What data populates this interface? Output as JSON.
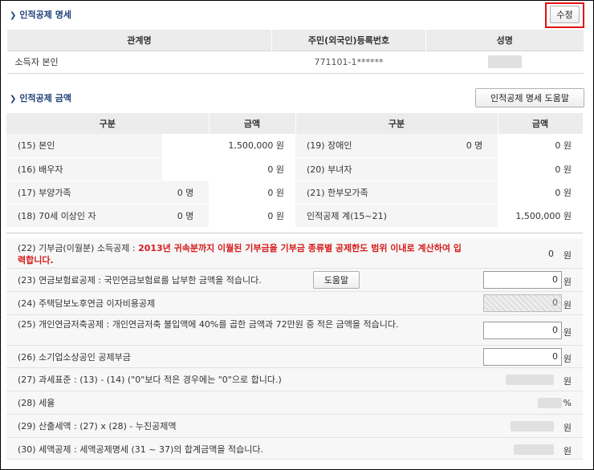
{
  "section1": {
    "title": "인적공제 명세",
    "edit_button": "수정"
  },
  "table1": {
    "headers": [
      "관계명",
      "주민(외국인)등록번호",
      "성명"
    ],
    "row": {
      "relation": "소득자 본인",
      "rrn_visible": "771101-1******",
      "name": ""
    }
  },
  "section2": {
    "title": "인적공제 금액",
    "help_button": "인적공제 명세 도움말"
  },
  "table2": {
    "headers": [
      "구분",
      "금액",
      "구분",
      "금액"
    ],
    "rows": [
      {
        "l_label": "(15) 본인",
        "l_count": "",
        "l_amount": "1,500,000",
        "l_unit": "원",
        "r_label": "(19) 장애인",
        "r_count": "0 명",
        "r_amount": "0",
        "r_unit": "원"
      },
      {
        "l_label": "(16) 배우자",
        "l_count": "",
        "l_amount": "0",
        "l_unit": "원",
        "r_label": "(20) 부녀자",
        "r_count": "",
        "r_amount": "0",
        "r_unit": "원"
      },
      {
        "l_label": "(17) 부양가족",
        "l_count": "0 명",
        "l_amount": "0",
        "l_unit": "원",
        "r_label": "(21) 한부모가족",
        "r_count": "",
        "r_amount": "0",
        "r_unit": "원"
      },
      {
        "l_label": "(18) 70세 이상인 자",
        "l_count": "0 명",
        "l_amount": "0",
        "l_unit": "원",
        "r_label": "인적공제 계(15~21)",
        "r_count": "",
        "r_amount": "1,500,000",
        "r_unit": "원"
      }
    ]
  },
  "items": [
    {
      "label": "(22) 기부금(이월분) 소득공제 : ",
      "note": "2013년 귀속분까지 이월된 기부금을 기부금 종류별 공제한도 범위 이내로 계산하여 입력합니다.",
      "value": "0",
      "unit": "원"
    },
    {
      "label": "(23) 연금보험료공제 : 국민연금보험료를 납부한 금액을 적습니다.",
      "help": "도움말",
      "value": "0",
      "unit": "원"
    },
    {
      "label": "(24) 주택담보노후연금 이자비용공제",
      "value": "0",
      "unit": "원"
    },
    {
      "label": "(25) 개인연금저축공제 : 개인연금저축 불입액에 40%를 곱한 금액과 72만원 중 적은 금액을 적습니다.",
      "value": "0",
      "unit": "원"
    },
    {
      "label": "(26) 소기업소상공인 공제부금",
      "value": "0",
      "unit": "원"
    },
    {
      "label": "(27) 과세표준 : (13) - (14) (\"0\"보다 적은 경우에는 \"0\"으로 합니다.)",
      "value": "",
      "unit": "원"
    },
    {
      "label": "(28) 세율",
      "value": "",
      "unit": "%"
    },
    {
      "label": "(29) 산출세액 : (27) x (28) - 누진공제액",
      "value": "",
      "unit": "원"
    },
    {
      "label": "(30) 세액공제 : 세액공제명세 (31 ~ 37)의 합계금액을 적습니다.",
      "value": "",
      "unit": "원"
    }
  ],
  "colors": {
    "title": "#1f3f7a",
    "highlight": "#e01010",
    "note": "#d81b1b"
  }
}
